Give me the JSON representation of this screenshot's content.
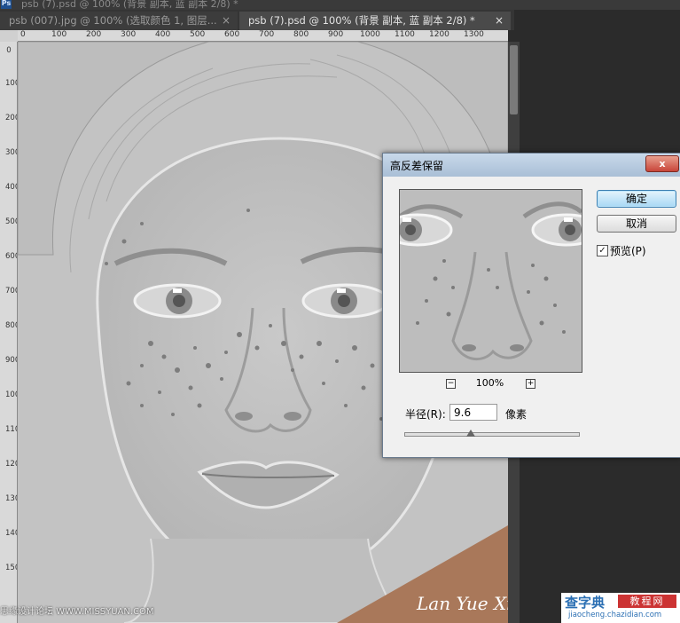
{
  "app": {
    "logo": "Ps",
    "title": "psb (7).psd @ 100% (背景 副本, 蓝 副本 2/8) *"
  },
  "tabs": [
    {
      "label": "psb (007).jpg @ 100% (选取颜色 1, 图层...",
      "close": "×"
    },
    {
      "label": "psb (7).psd @ 100% (背景 副本, 蓝 副本 2/8) *",
      "close": "×"
    }
  ],
  "ruler": {
    "h_ticks": [
      "0",
      "100",
      "200",
      "300",
      "400",
      "500",
      "600",
      "700",
      "800",
      "900",
      "1000",
      "1100",
      "1200",
      "1300"
    ],
    "v_ticks": [
      "0",
      "100",
      "200",
      "300",
      "400",
      "500",
      "600",
      "700",
      "800",
      "900",
      "1000",
      "1100",
      "1200",
      "1300",
      "1400",
      "1500"
    ]
  },
  "watermarks": {
    "bottom_left": "思缘设计论坛 WWW.MISSYUAN.COM",
    "signature": "Lan Yue Xin 教程",
    "site_big": "查字典",
    "site_box": "教程网",
    "site_url": "jiaocheng.chazidian.com"
  },
  "dialog": {
    "title": "高反差保留",
    "close": "x",
    "ok": "确定",
    "cancel": "取消",
    "preview_label": "预览(P)",
    "preview_checked": true,
    "zoom_minus": "−",
    "zoom_level": "100%",
    "zoom_plus": "+",
    "radius_label": "半径(R):",
    "radius_value": "9.6",
    "radius_unit": "像素",
    "slider_fraction": 0.38
  },
  "colors": {
    "accent_stripe": "#a9785a",
    "dialog_title": "#a9bfd6"
  }
}
